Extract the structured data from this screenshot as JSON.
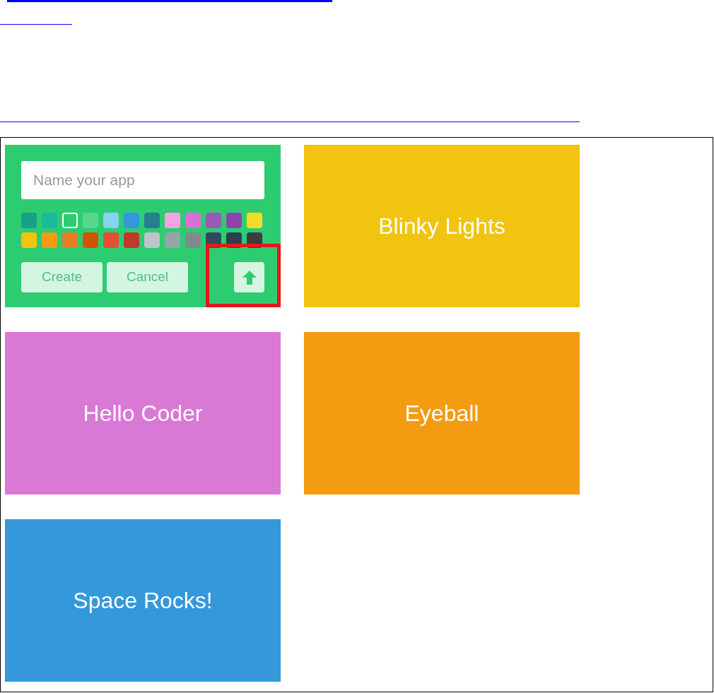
{
  "new_app_card": {
    "color": "#2ecc71",
    "name_field": {
      "placeholder": "Name your app"
    },
    "swatches": [
      {
        "color": "#16a085",
        "selected": false
      },
      {
        "color": "#1abc9c",
        "selected": false
      },
      {
        "color": "#2ecc71",
        "selected": true
      },
      {
        "color": "#58d68d",
        "selected": false
      },
      {
        "color": "#85d3ef",
        "selected": false
      },
      {
        "color": "#3498db",
        "selected": false
      },
      {
        "color": "#25808a",
        "selected": false
      },
      {
        "color": "#f0a6dc",
        "selected": false
      },
      {
        "color": "#da70d6",
        "selected": false
      },
      {
        "color": "#9b59b6",
        "selected": false
      },
      {
        "color": "#8e44ad",
        "selected": false
      },
      {
        "color": "#f5dc2c",
        "selected": false
      },
      {
        "color": "#f1c40f",
        "selected": false
      },
      {
        "color": "#f39c12",
        "selected": false
      },
      {
        "color": "#e67e22",
        "selected": false
      },
      {
        "color": "#d35400",
        "selected": false
      },
      {
        "color": "#e74c3c",
        "selected": false
      },
      {
        "color": "#c0392b",
        "selected": false
      },
      {
        "color": "#bdc3c7",
        "selected": false
      },
      {
        "color": "#95a5a6",
        "selected": false
      },
      {
        "color": "#7f8c8d",
        "selected": false
      },
      {
        "color": "#34495e",
        "selected": false
      },
      {
        "color": "#2c3e50",
        "selected": false
      },
      {
        "color": "#3d3d3d",
        "selected": false
      }
    ],
    "buttons": [
      "Create",
      "Cancel"
    ]
  },
  "apps": [
    {
      "name": "Blinky Lights",
      "color": "#f1c40f"
    },
    {
      "name": "Hello Coder",
      "color": "#da78d6"
    },
    {
      "name": "Eyeball",
      "color": "#f39c12"
    },
    {
      "name": "Space Rocks!",
      "color": "#3498db"
    }
  ]
}
